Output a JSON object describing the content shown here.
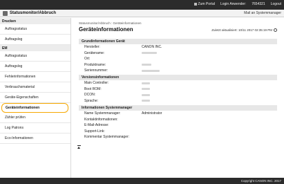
{
  "topbar": {
    "portal": "Zum Portal",
    "login_user": "Login Anwender:",
    "user_id": "7654321",
    "logout": "Logout"
  },
  "titlebar": {
    "title": "Statusmonitor/Abbruch",
    "mail_button": "Mail an Systemmanager"
  },
  "sidebar": {
    "groups": [
      {
        "label": "Drucken",
        "items": [
          "Auftragsstatus",
          "Auftragslog"
        ]
      },
      {
        "label": "EM",
        "items": [
          "Auftragsstatus",
          "Auftragslog",
          "Fehlerinformationen",
          "Verbrauchsmaterial",
          "Geräte-Eigenschaften",
          "Geräteinformationen",
          "Zähler prüfen",
          "Log Patrons",
          "Eco-Informationen"
        ]
      }
    ]
  },
  "main": {
    "breadcrumb": "Statusmonitor/Abbruch : Geräteinformationen",
    "title": "Geräteinformationen",
    "updated": "Zuletzt aktualisiert: 10/11 2017 02:35:19 PM",
    "sections": [
      {
        "title": "Grundinformationen Gerät",
        "rows": [
          {
            "key": "Hersteller:",
            "value": "CANON INC."
          },
          {
            "key": "Gerätename:",
            "value": ""
          },
          {
            "key": "Ort:",
            "value": ""
          },
          {
            "key": "Produktname:",
            "value": ""
          },
          {
            "key": "Seriennummer:",
            "value": ""
          }
        ]
      },
      {
        "title": "Versionsinformationen",
        "rows": [
          {
            "key": "Main Controller:",
            "value": ""
          },
          {
            "key": "Boot ROM:",
            "value": ""
          },
          {
            "key": "DCON:",
            "value": ""
          },
          {
            "key": "Sprache:",
            "value": ""
          }
        ]
      },
      {
        "title": "Informationen Systemmanager",
        "rows": [
          {
            "key": "Name Systemmanager:",
            "value": "Administrator"
          },
          {
            "key": "Kontaktinformationen:",
            "value": ""
          },
          {
            "key": "E-Mail-Adresse:",
            "value": ""
          },
          {
            "key": "Support-Link:",
            "value": ""
          },
          {
            "key": "Kommentar Systemmanager:",
            "value": ""
          }
        ]
      }
    ]
  },
  "footer": {
    "copyright": "Copyright CANON INC. 2017"
  },
  "colors": {
    "active_outline": "#f6a800",
    "bar": "#2b2b2b"
  }
}
